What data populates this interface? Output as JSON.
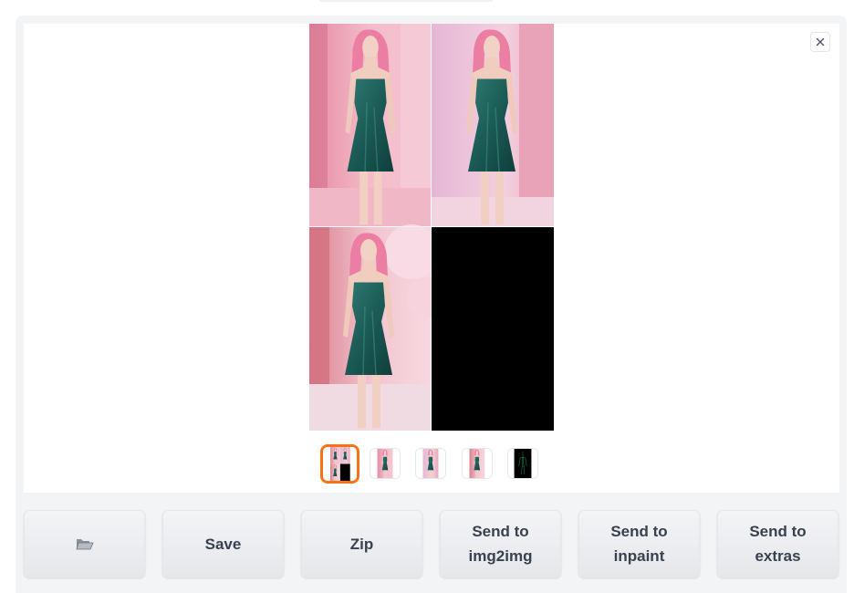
{
  "gallery": {
    "close_icon": "close-icon",
    "main_image": {
      "description": "2x2 grid: three photos of a woman with pink hair in a teal satin slip dress, and a black pose map",
      "panels": [
        "photo-1",
        "photo-2",
        "photo-3",
        "pose-map"
      ]
    },
    "thumbnails": [
      {
        "name": "grid",
        "selected": true
      },
      {
        "name": "photo-1",
        "selected": false
      },
      {
        "name": "photo-2",
        "selected": false
      },
      {
        "name": "photo-3",
        "selected": false
      },
      {
        "name": "pose-map",
        "selected": false
      }
    ],
    "selected_color": "#f97316"
  },
  "actions": {
    "folder_icon": "open-folder-icon",
    "save_label": "Save",
    "zip_label": "Zip",
    "img2img_label": "Send to\nimg2img",
    "inpaint_label": "Send to\ninpaint",
    "extras_label": "Send to\nextras"
  }
}
